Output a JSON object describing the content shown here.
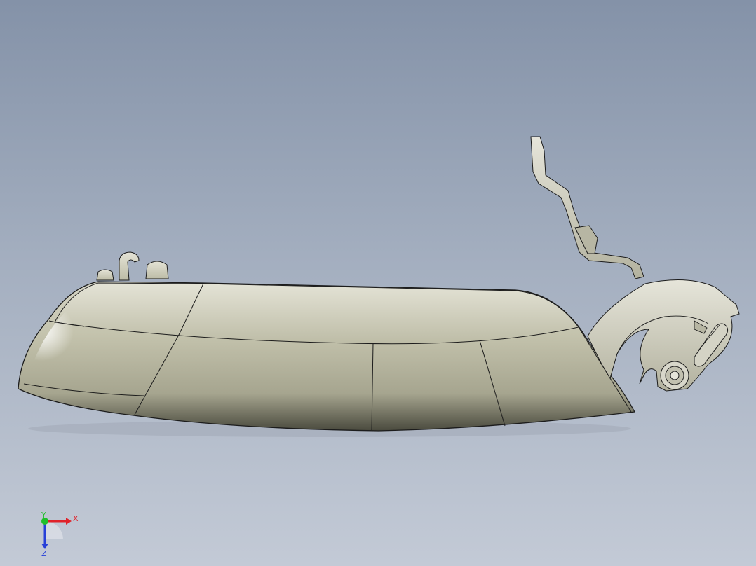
{
  "viewport": {
    "background_top": "#8492a8",
    "background_bottom": "#c3cad6"
  },
  "model": {
    "body_color": "#b9b8a2",
    "edge_color": "#1c1c1c",
    "bracket_color": "#c9c8b8"
  },
  "triad": {
    "x_label": "X",
    "y_label": "Y",
    "z_label": "Z",
    "x_color": "#e0222a",
    "y_color": "#1fbf2a",
    "z_color": "#2740d8"
  }
}
